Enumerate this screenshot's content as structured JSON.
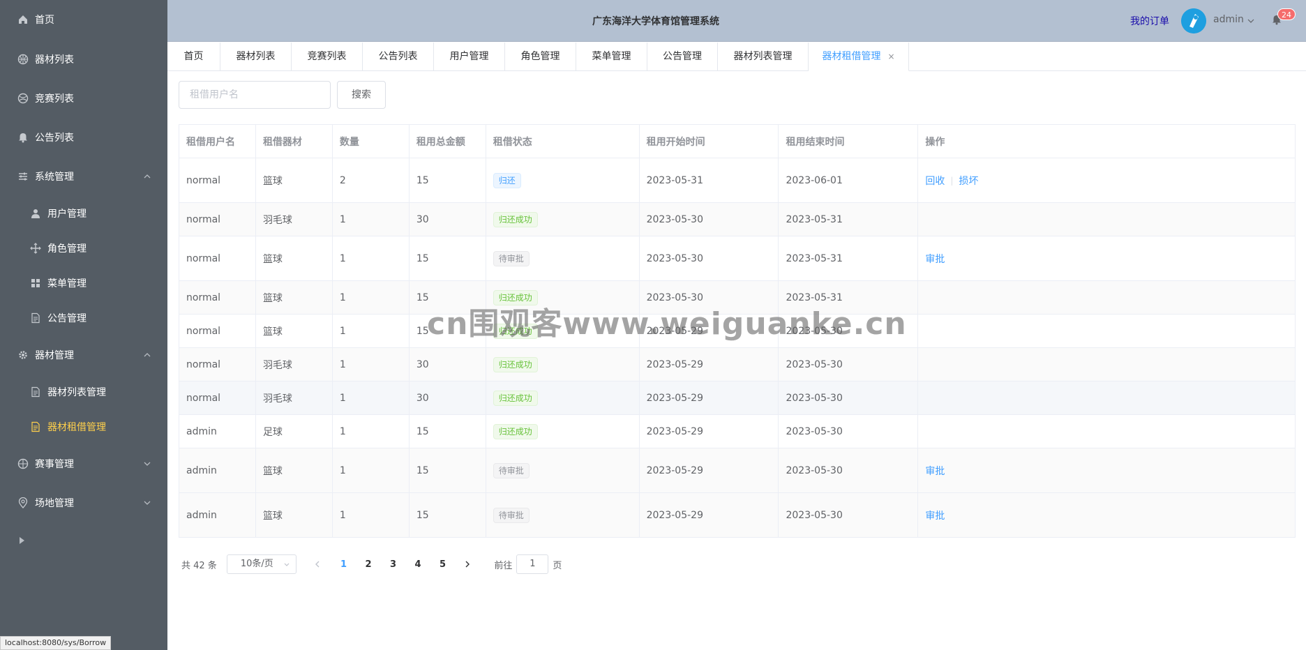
{
  "header": {
    "title": "广东海洋大学体育馆管理系统",
    "my_order": "我的订单",
    "user": "admin",
    "badge_count": "24"
  },
  "sidebar": {
    "items": [
      {
        "label": "首页",
        "icon": "home-icon"
      },
      {
        "label": "器材列表",
        "icon": "basketball-icon"
      },
      {
        "label": "竞赛列表",
        "icon": "ball-icon"
      },
      {
        "label": "公告列表",
        "icon": "bell-icon"
      },
      {
        "label": "系统管理",
        "icon": "sliders-icon"
      },
      {
        "label": "用户管理",
        "icon": "user-icon"
      },
      {
        "label": "角色管理",
        "icon": "rank-icon"
      },
      {
        "label": "菜单管理",
        "icon": "menu-grid-icon"
      },
      {
        "label": "公告管理",
        "icon": "document-icon"
      },
      {
        "label": "器材管理",
        "icon": "gear-icon"
      },
      {
        "label": "器材列表管理",
        "icon": "document-icon"
      },
      {
        "label": "器材租借管理",
        "icon": "document-icon"
      },
      {
        "label": "赛事管理",
        "icon": "basketball-icon"
      },
      {
        "label": "场地管理",
        "icon": "location-icon"
      }
    ],
    "active": "器材租借管理"
  },
  "status_url": "localhost:8080/sys/Borrow",
  "tabs": [
    {
      "label": "首页"
    },
    {
      "label": "器材列表"
    },
    {
      "label": "竞赛列表"
    },
    {
      "label": "公告列表"
    },
    {
      "label": "用户管理"
    },
    {
      "label": "角色管理"
    },
    {
      "label": "菜单管理"
    },
    {
      "label": "公告管理"
    },
    {
      "label": "器材列表管理"
    },
    {
      "label": "器材租借管理",
      "close": "×"
    }
  ],
  "search": {
    "placeholder": "租借用户名",
    "button": "搜索"
  },
  "table": {
    "columns": [
      "租借用户名",
      "租借器材",
      "数量",
      "租用总金额",
      "租借状态",
      "租用开始时间",
      "租用结束时间",
      "操作"
    ],
    "rows": [
      {
        "user": "normal",
        "item": "篮球",
        "qty": "2",
        "amount": "15",
        "status": "归还",
        "status_type": "primary",
        "start": "2023-05-31",
        "end": "2023-06-01",
        "ops": [
          "回收",
          "损坏"
        ]
      },
      {
        "user": "normal",
        "item": "羽毛球",
        "qty": "1",
        "amount": "30",
        "status": "归还成功",
        "status_type": "success",
        "start": "2023-05-30",
        "end": "2023-05-31",
        "ops": []
      },
      {
        "user": "normal",
        "item": "篮球",
        "qty": "1",
        "amount": "15",
        "status": "待审批",
        "status_type": "info",
        "start": "2023-05-30",
        "end": "2023-05-31",
        "ops": [
          "审批"
        ]
      },
      {
        "user": "normal",
        "item": "篮球",
        "qty": "1",
        "amount": "15",
        "status": "归还成功",
        "status_type": "success",
        "start": "2023-05-30",
        "end": "2023-05-31",
        "ops": []
      },
      {
        "user": "normal",
        "item": "篮球",
        "qty": "1",
        "amount": "15",
        "status": "归还成功",
        "status_type": "success",
        "start": "2023-05-29",
        "end": "2023-05-30",
        "ops": []
      },
      {
        "user": "normal",
        "item": "羽毛球",
        "qty": "1",
        "amount": "30",
        "status": "归还成功",
        "status_type": "success",
        "start": "2023-05-29",
        "end": "2023-05-30",
        "ops": []
      },
      {
        "user": "normal",
        "item": "羽毛球",
        "qty": "1",
        "amount": "30",
        "status": "归还成功",
        "status_type": "success",
        "start": "2023-05-29",
        "end": "2023-05-30",
        "ops": []
      },
      {
        "user": "admin",
        "item": "足球",
        "qty": "1",
        "amount": "15",
        "status": "归还成功",
        "status_type": "success",
        "start": "2023-05-29",
        "end": "2023-05-30",
        "ops": []
      },
      {
        "user": "admin",
        "item": "篮球",
        "qty": "1",
        "amount": "15",
        "status": "待审批",
        "status_type": "info",
        "start": "2023-05-29",
        "end": "2023-05-30",
        "ops": [
          "审批"
        ]
      },
      {
        "user": "admin",
        "item": "篮球",
        "qty": "1",
        "amount": "15",
        "status": "待审批",
        "status_type": "info",
        "start": "2023-05-29",
        "end": "2023-05-30",
        "ops": [
          "审批"
        ]
      }
    ]
  },
  "pagination": {
    "total": "共 42 条",
    "page_size": "10条/页",
    "pages": [
      "1",
      "2",
      "3",
      "4",
      "5"
    ],
    "current": "1",
    "goto_label": "前往",
    "goto_value": "1",
    "page_suffix": "页"
  },
  "watermark": "cn围观客www.weiguanke.cn",
  "colors": {
    "sidebar_bg": "#545c64",
    "header_bg": "#b3c0d1",
    "accent": "#409eff",
    "active_menu": "#ffd04b"
  }
}
